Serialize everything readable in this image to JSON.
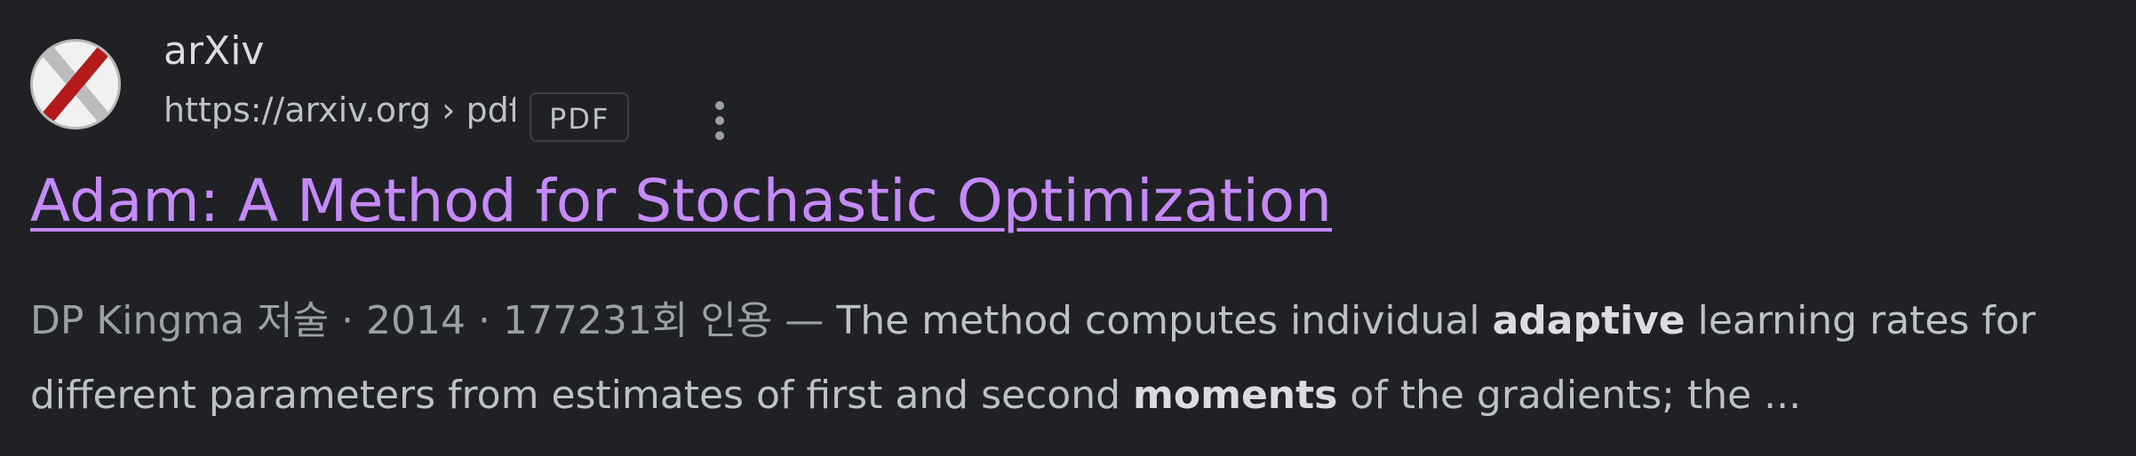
{
  "site": {
    "name": "arXiv",
    "url": "https://arxiv.org › pdf",
    "badge": "PDF",
    "favicon_icon": "arxiv-logo-icon"
  },
  "result": {
    "title": "Adam: A Method for Stochastic Optimization",
    "meta": "DP Kingma 저술 · 2014 · 177231회 인용 — ",
    "snippet_part1": "The method computes individual ",
    "snippet_bold1": "adaptive",
    "snippet_part2": " learning rates for different parameters from estimates of first and second ",
    "snippet_bold2": "moments",
    "snippet_part3": " of the gradients; the ..."
  },
  "more_options_icon": "more-vert-icon",
  "colors": {
    "background": "#202124",
    "title_link": "#c58af9",
    "text": "#bdc1c6"
  }
}
